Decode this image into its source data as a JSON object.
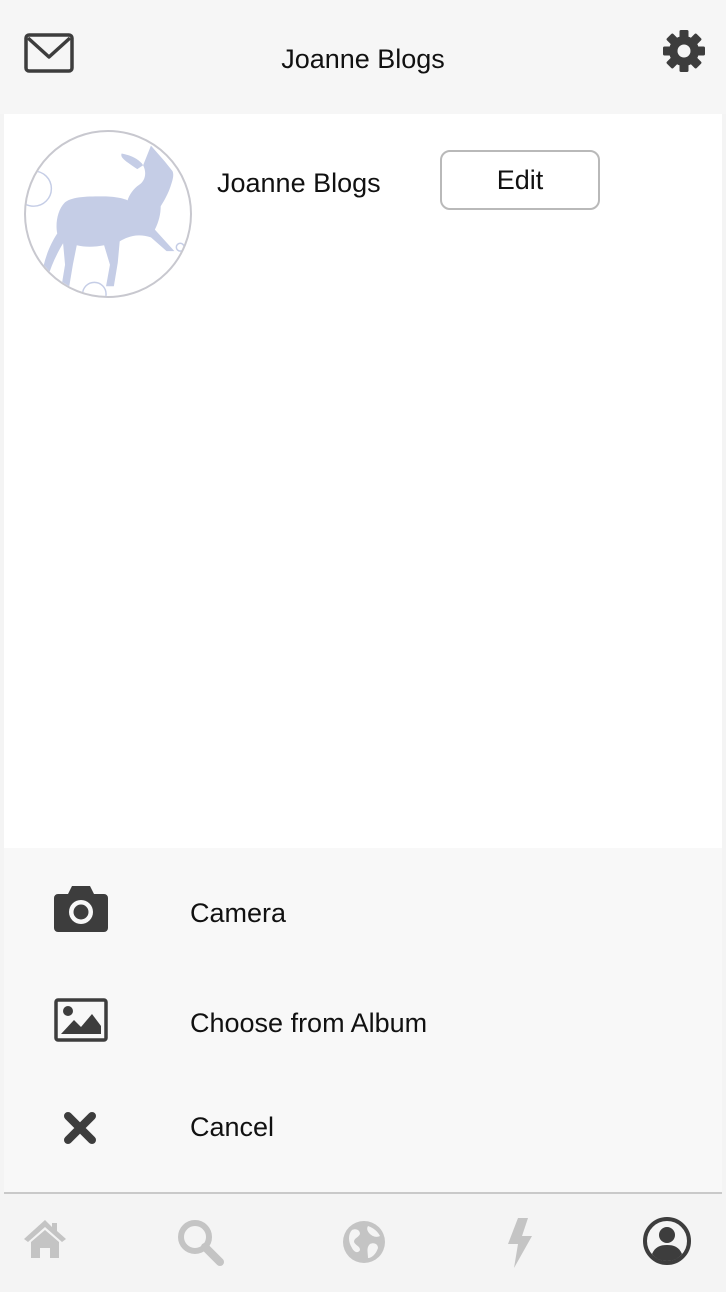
{
  "header": {
    "title": "Joanne Blogs",
    "left_icon": "mail-icon",
    "right_icon": "gear-icon"
  },
  "profile": {
    "name": "Joanne Blogs",
    "edit_label": "Edit",
    "avatar_icon": "unicorn-avatar"
  },
  "action_sheet": {
    "items": [
      {
        "label": "Camera",
        "icon": "camera-icon"
      },
      {
        "label": "Choose from Album",
        "icon": "image-icon"
      },
      {
        "label": "Cancel",
        "icon": "close-icon"
      }
    ]
  },
  "tabbar": {
    "items": [
      {
        "icon": "home-icon",
        "active": false
      },
      {
        "icon": "search-icon",
        "active": false
      },
      {
        "icon": "globe-icon",
        "active": false
      },
      {
        "icon": "lightning-icon",
        "active": false
      },
      {
        "icon": "profile-icon",
        "active": true
      }
    ]
  },
  "colors": {
    "icon_dark": "#3d3d3d",
    "icon_inactive": "#c4c4c4",
    "avatar_fill": "#c5cde6",
    "sheet_bg": "#f8f8f8"
  }
}
